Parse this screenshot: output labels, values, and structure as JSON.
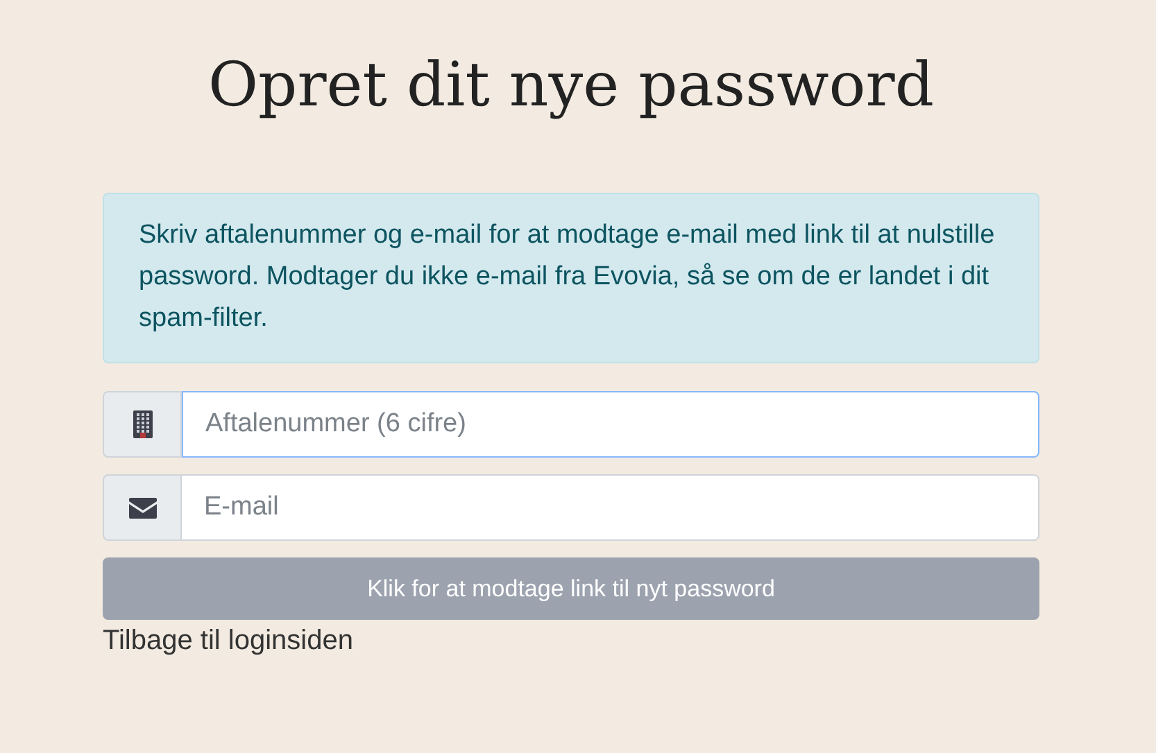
{
  "title": "Opret dit nye password",
  "alert": "Skriv aftalenummer og e-mail for at modtage e-mail med link til at nulstille password. Modtager du ikke e-mail fra Evovia, så se om de er landet i dit spam-filter.",
  "fields": [
    {
      "kind": "building",
      "placeholder": "Aftalenummer (6 cifre)",
      "focused": true
    },
    {
      "kind": "envelope",
      "placeholder": "E-mail",
      "focused": false
    }
  ],
  "submit": {
    "label": "Klik for at modtage link til nyt password",
    "disabled": true
  },
  "back_link": "Tilbage til loginsiden"
}
